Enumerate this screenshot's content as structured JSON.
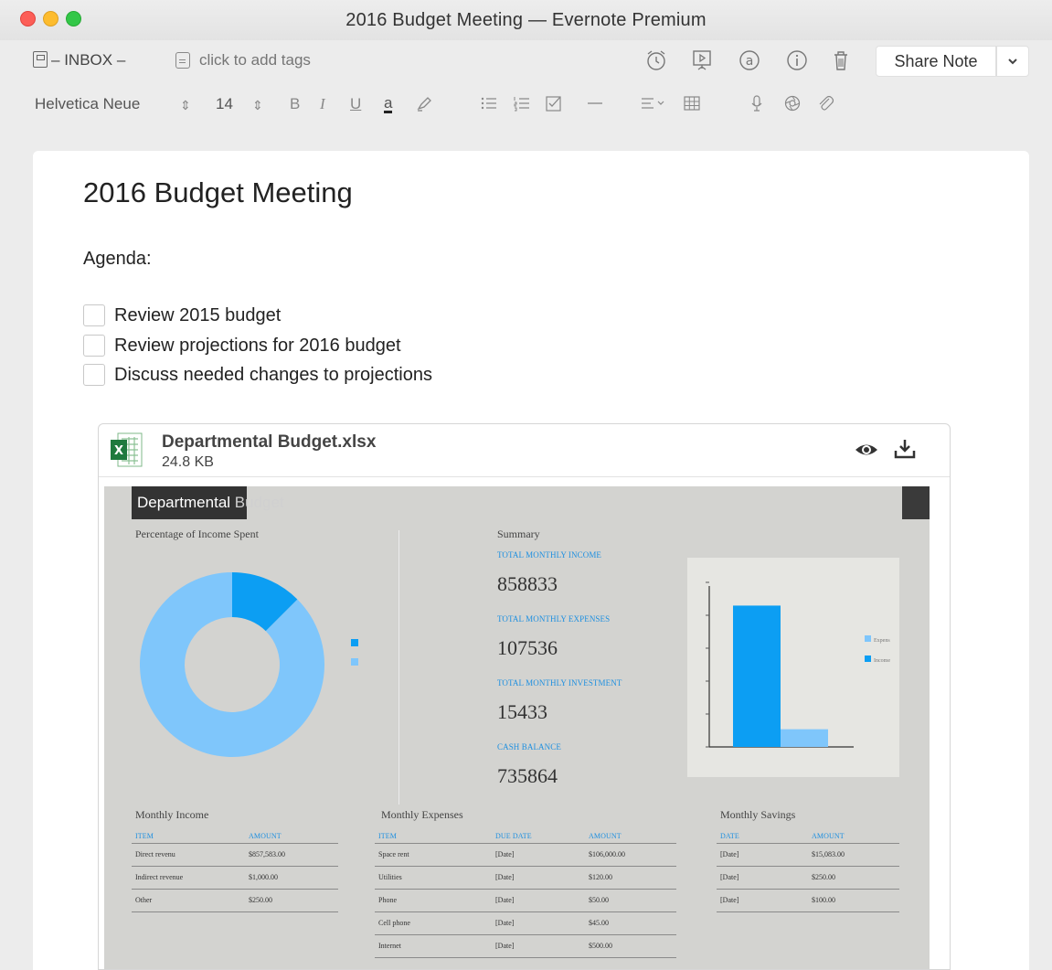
{
  "window": {
    "title": "2016 Budget Meeting — Evernote Premium"
  },
  "toolbar": {
    "notebook_label": "INBOX",
    "notebook_dash": "–",
    "tags_placeholder": "click to add tags",
    "share_label": "Share Note",
    "icons": [
      "reminder-icon",
      "presentation-icon",
      "at-mention-icon",
      "info-icon",
      "trash-icon"
    ]
  },
  "format_bar": {
    "font_family": "Helvetica Neue",
    "font_size": "14",
    "bold": "B",
    "italic": "I",
    "underline": "U",
    "text_color": "a"
  },
  "note": {
    "title": "2016 Budget Meeting",
    "agenda_label": "Agenda:",
    "todos": [
      {
        "label": "Review 2015 budget",
        "checked": false
      },
      {
        "label": "Review projections for 2016 budget",
        "checked": false
      },
      {
        "label": "Discuss needed changes to projections",
        "checked": false
      }
    ]
  },
  "attachment": {
    "file_name": "Departmental Budget.xlsx",
    "file_size": "24.8 KB"
  },
  "sheet": {
    "title_a": "Departmental ",
    "title_b": "Budget",
    "pct_label": "Percentage of Income Spent",
    "summary_label": "Summary",
    "income_label": "TOTAL MONTHLY INCOME",
    "income_value": "858833",
    "expenses_label": "TOTAL MONTHLY EXPENSES",
    "expenses_value": "107536",
    "investment_label": "TOTAL MONTHLY INVESTMENT",
    "investment_value": "15433",
    "cash_label": "CASH BALANCE",
    "cash_value": "735864",
    "bar_legend": [
      "Expens",
      "Income"
    ],
    "colors": {
      "light": "#7fc6fb",
      "dark": "#0c9ef3"
    },
    "monthly_income": {
      "heading": "Monthly Income",
      "columns": [
        "ITEM",
        "AMOUNT"
      ],
      "rows": [
        [
          "Direct revenu",
          "$857,583.00"
        ],
        [
          "Indirect revenue",
          "$1,000.00"
        ],
        [
          "Other",
          "$250.00"
        ]
      ]
    },
    "monthly_expenses": {
      "heading": "Monthly Expenses",
      "columns": [
        "ITEM",
        "DUE DATE",
        "AMOUNT"
      ],
      "rows": [
        [
          "Space rent",
          "[Date]",
          "$106,000.00"
        ],
        [
          "Utilities",
          "[Date]",
          "$120.00"
        ],
        [
          "Phone",
          "[Date]",
          "$50.00"
        ],
        [
          "Cell phone",
          "[Date]",
          "$45.00"
        ],
        [
          "Internet",
          "[Date]",
          "$500.00"
        ]
      ]
    },
    "monthly_savings": {
      "heading": "Monthly Savings",
      "columns": [
        "DATE",
        "AMOUNT"
      ],
      "rows": [
        [
          "[Date]",
          "$15,083.00"
        ],
        [
          "[Date]",
          "$250.00"
        ],
        [
          "[Date]",
          "$100.00"
        ]
      ]
    }
  },
  "chart_data": [
    {
      "type": "pie",
      "title": "Percentage of Income Spent",
      "donut": true,
      "categories": [
        "",
        ""
      ],
      "values": [
        12.5,
        87.5
      ]
    },
    {
      "type": "bar",
      "categories": [
        "",
        ""
      ],
      "series": [
        {
          "name": "Expens",
          "values": [
            0,
            107536
          ]
        },
        {
          "name": "Income",
          "values": [
            858833,
            0
          ]
        }
      ]
    }
  ]
}
